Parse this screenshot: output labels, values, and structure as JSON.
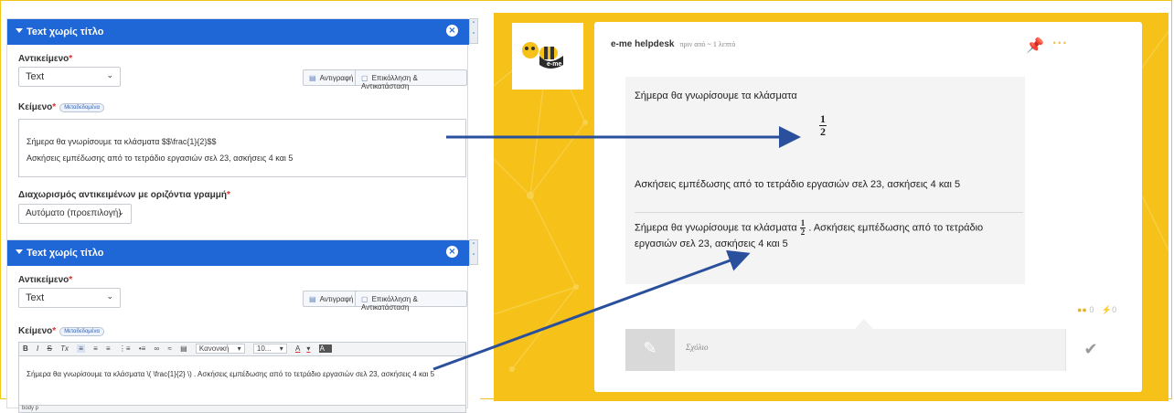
{
  "editor": {
    "panels": [
      {
        "title": "Text χωρίς τίτλο",
        "object_label": "Αντικείμενο",
        "object_value": "Text",
        "copy_label": "Αντιγραφή",
        "paste_label": "Επικόλληση & Αντικατάσταση",
        "text_label": "Κείμενο",
        "text_badge": "Μεταδεδομένα",
        "line1": "Σήμερα θα γνωρίσουμε τα κλάσματα  $$\\frac{1}{2}$$",
        "line2": "Ασκήσεις εμπέδωσης από το τετράδιο εργασιών σελ 23, ασκήσεις 4 και 5",
        "separator_label": "Διαχωρισμός αντικειμένων με οριζόντια γραμμή",
        "separator_value": "Αυτόματο (προεπιλογή)"
      },
      {
        "title": "Text χωρίς τίτλο",
        "object_label": "Αντικείμενο",
        "object_value": "Text",
        "copy_label": "Αντιγραφή",
        "paste_label": "Επικόλληση & Αντικατάσταση",
        "text_label": "Κείμενο",
        "text_badge": "Μεταδεδομένα",
        "toolbar": {
          "bold": "B",
          "italic": "I",
          "strike": "S",
          "clear": "Tx",
          "format_value": "Κανονική",
          "size_value": "10...",
          "font_color": "A",
          "bg_color": "A"
        },
        "line1": "Σήμερα θα γνωρίσουμε τα κλάσματα  \\( \\frac{1}{2} \\)  . Ασκήσεις εμπέδωσης από το τετράδιο εργασιών σελ 23, ασκήσεις 4 και 5",
        "statusbar": "body  p"
      }
    ]
  },
  "preview": {
    "logo_text": "e-me",
    "author": "e-me helpdesk",
    "time": "πριν από ~ 1 λεπτό",
    "block1_text": "Σήμερα θα γνωρίσουμε τα κλάσματα",
    "frac_num": "1",
    "frac_den": "2",
    "block1_exercise": "Ασκήσεις εμπέδωσης από το τετράδιο εργασιών σελ 23, ασκήσεις 4 και 5",
    "block2_before": "Σήμερα θα γνωρίσουμε τα κλάσματα",
    "block2_after": ". Ασκήσεις εμπέδωσης από το τετράδιο",
    "block2_line2": "εργασιών σελ 23, ασκήσεις 4 και 5",
    "comment_count": "0",
    "like_count": "0",
    "comment_placeholder": "Σχόλιο",
    "colors": {
      "accent": "#1f66d6",
      "background": "#f6c21a",
      "arrow": "#2a4f9c"
    }
  }
}
